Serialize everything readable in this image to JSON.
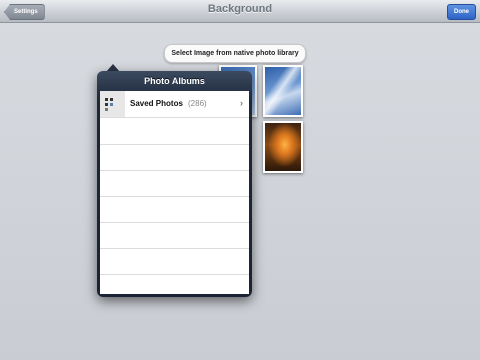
{
  "navbar": {
    "title": "Background",
    "back_label": "Settings",
    "done_label": "Done"
  },
  "tooltip": {
    "text": "Select Image from native photo library"
  },
  "popover": {
    "title": "Photo Albums",
    "albums": [
      {
        "name": "Saved Photos",
        "count": "(286)"
      }
    ],
    "chevron": "›"
  },
  "colors": {
    "done_button": "#2d63c8",
    "popover_header": "#1c2738"
  },
  "icons": [
    "chevron-right-icon",
    "album-thumbnail-icon"
  ]
}
